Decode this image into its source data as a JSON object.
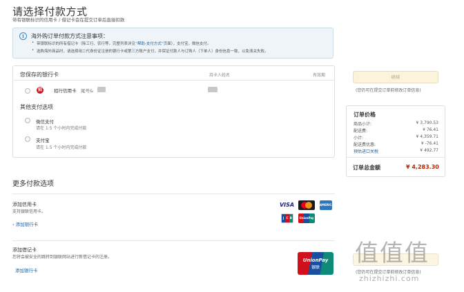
{
  "header": {
    "title": "请选择付款方式",
    "subtitle": "带有银联标识的信用卡 / 借记卡会在提交订单后直接扣款"
  },
  "notice": {
    "icon": "info-icon",
    "title": "海外购订单付款方式注意事项：",
    "line1_prefix": "带银联标识的所有借记卡（除工行、农行等，完整列表详见",
    "line1_link": "“帮助-支付方式”",
    "line1_suffix": "页面），支付宝，微信支付。",
    "line2": "选购海外商品时，请选择用二代身份证注册的银行卡或第三方账户支付，并保证付款人与订购人（下单人）身份信息一致，以免清关失败。"
  },
  "saved_cards": {
    "heading": "您保存的银行卡",
    "col_holder": "持卡人姓名",
    "col_expiry": "有效期",
    "card": {
      "bank": "招行信用卡",
      "tail": "尾号&"
    }
  },
  "other_options": {
    "heading": "其他支付选项",
    "wechat": {
      "name": "微信支付",
      "note": "请在 1.5 个小时内完成付款"
    },
    "alipay": {
      "name": "支付宝",
      "note": "请在 1.5 个小时内完成付款"
    }
  },
  "more_options": {
    "heading": "更多付款选项",
    "credit": {
      "title": "添加信用卡",
      "desc": "支持银联信用卡。",
      "link": "添加银行卡"
    },
    "debit": {
      "title": "添加借记卡",
      "desc": "您将会被安全的跳转到银联网站进行新借记卡的注册。",
      "link": "添加银行卡"
    },
    "logos": {
      "visa": "VISA",
      "amex": "AMERICAN EXPRESS",
      "jcb": [
        "J",
        "C",
        "B"
      ],
      "unionpay_small": "UnionPay",
      "unionpay": "UnionPay",
      "unionpay_cn": "银联"
    }
  },
  "sidebar": {
    "pay_button": "继续",
    "hint": "(您仍可在提交订单前修改订单信息)",
    "summary_title": "订单价格",
    "rows": [
      {
        "k": "商品小计:",
        "v": "¥ 3,790.53"
      },
      {
        "k": "配送费:",
        "v": "¥ 76.41"
      },
      {
        "k": "小计:",
        "v": "¥ 4,359.71"
      },
      {
        "k": "配送费优惠:",
        "v": "¥ -76.41"
      },
      {
        "k": "预估进口关税",
        "v": "¥ 492.77"
      }
    ],
    "total_label": "订单总金额",
    "total_value": "¥ 4,283.30",
    "ghost_hint": "(您仍可在提交订单前修改订单信息)"
  },
  "watermark": {
    "glyphs": "值值值",
    "url": "zhizhizhi.com"
  }
}
